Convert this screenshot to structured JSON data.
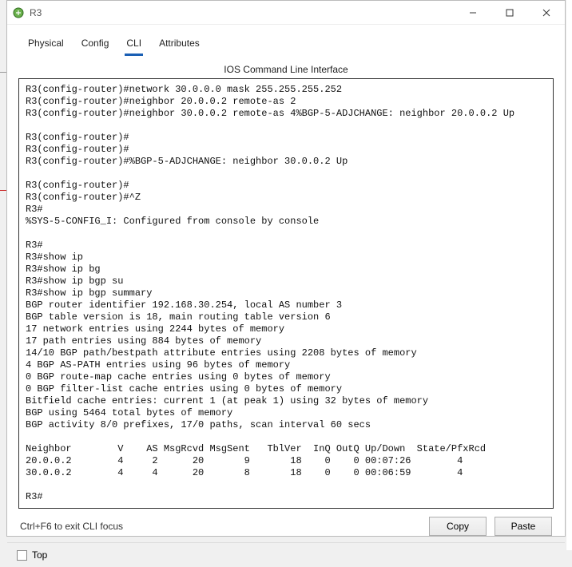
{
  "window": {
    "title": "R3"
  },
  "tabs": {
    "physical": "Physical",
    "config": "Config",
    "cli": "CLI",
    "attributes": "Attributes"
  },
  "cli_header": "IOS Command Line Interface",
  "terminal_text": "R3(config-router)#network 30.0.0.0 mask 255.255.255.252\nR3(config-router)#neighbor 20.0.0.2 remote-as 2\nR3(config-router)#neighbor 30.0.0.2 remote-as 4%BGP-5-ADJCHANGE: neighbor 20.0.0.2 Up\n\nR3(config-router)#\nR3(config-router)#\nR3(config-router)#%BGP-5-ADJCHANGE: neighbor 30.0.0.2 Up\n\nR3(config-router)#\nR3(config-router)#^Z\nR3#\n%SYS-5-CONFIG_I: Configured from console by console\n\nR3#\nR3#show ip\nR3#show ip bg\nR3#show ip bgp su\nR3#show ip bgp summary\nBGP router identifier 192.168.30.254, local AS number 3\nBGP table version is 18, main routing table version 6\n17 network entries using 2244 bytes of memory\n17 path entries using 884 bytes of memory\n14/10 BGP path/bestpath attribute entries using 2208 bytes of memory\n4 BGP AS-PATH entries using 96 bytes of memory\n0 BGP route-map cache entries using 0 bytes of memory\n0 BGP filter-list cache entries using 0 bytes of memory\nBitfield cache entries: current 1 (at peak 1) using 32 bytes of memory\nBGP using 5464 total bytes of memory\nBGP activity 8/0 prefixes, 17/0 paths, scan interval 60 secs\n\nNeighbor        V    AS MsgRcvd MsgSent   TblVer  InQ OutQ Up/Down  State/PfxRcd\n20.0.0.2        4     2      20       9       18    0    0 00:07:26        4\n30.0.0.2        4     4      20       8       18    0    0 00:06:59        4\n\nR3#",
  "hint": "Ctrl+F6 to exit CLI focus",
  "buttons": {
    "copy": "Copy",
    "paste": "Paste"
  },
  "footer": {
    "top_label": "Top"
  },
  "bgp_summary": {
    "router_id": "192.168.30.254",
    "local_as": 3,
    "table_version": 18,
    "main_routing_table_version": 6,
    "network_entries": 17,
    "network_entries_bytes": 2244,
    "path_entries": 17,
    "path_entries_bytes": 884,
    "bestpath_attr": "14/10",
    "bestpath_attr_bytes": 2208,
    "as_path_entries": 4,
    "as_path_bytes": 96,
    "route_map_cache": 0,
    "filter_list_cache": 0,
    "bitfield_current": 1,
    "bitfield_peak": 1,
    "bitfield_bytes": 32,
    "total_bytes": 5464,
    "activity_prefixes": "8/0",
    "activity_paths": "17/0",
    "scan_interval_secs": 60,
    "neighbors": [
      {
        "ip": "20.0.0.2",
        "v": 4,
        "as": 2,
        "msg_rcvd": 20,
        "msg_sent": 9,
        "tbl_ver": 18,
        "inq": 0,
        "outq": 0,
        "up_down": "00:07:26",
        "pfx_rcd": 4
      },
      {
        "ip": "30.0.0.2",
        "v": 4,
        "as": 4,
        "msg_rcvd": 20,
        "msg_sent": 8,
        "tbl_ver": 18,
        "inq": 0,
        "outq": 0,
        "up_down": "00:06:59",
        "pfx_rcd": 4
      }
    ]
  }
}
